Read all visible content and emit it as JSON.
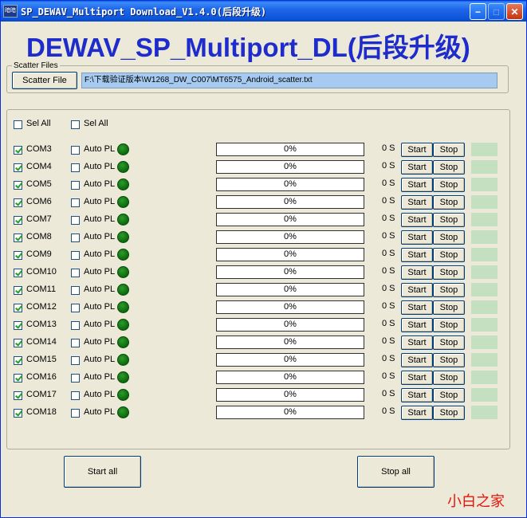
{
  "window": {
    "title": "SP_DEWAV_Multiport Download_V1.4.0(后段升级)",
    "app_icon": "暗暗",
    "minimize_glyph": "−",
    "maximize_glyph": "□",
    "close_glyph": "✕"
  },
  "banner": "DEWAV_SP_Multiport_DL(后段升级)",
  "scatter": {
    "legend": "Scatter Files",
    "button": "Scatter File",
    "path": "F:\\下载验证版本\\W1268_DW_C007\\MT6575_Android_scatter.txt"
  },
  "header": {
    "sel_all_1": "Sel All",
    "sel_all_2": "Sel All"
  },
  "ports": [
    {
      "name": "COM3",
      "checked": true,
      "auto_pl": "Auto PL",
      "progress": 0,
      "progress_text": "0%",
      "time": "0 S",
      "start": "Start",
      "stop": "Stop"
    },
    {
      "name": "COM4",
      "checked": true,
      "auto_pl": "Auto PL",
      "progress": 0,
      "progress_text": "0%",
      "time": "0 S",
      "start": "Start",
      "stop": "Stop"
    },
    {
      "name": "COM5",
      "checked": true,
      "auto_pl": "Auto PL",
      "progress": 0,
      "progress_text": "0%",
      "time": "0 S",
      "start": "Start",
      "stop": "Stop"
    },
    {
      "name": "COM6",
      "checked": true,
      "auto_pl": "Auto PL",
      "progress": 0,
      "progress_text": "0%",
      "time": "0 S",
      "start": "Start",
      "stop": "Stop"
    },
    {
      "name": "COM7",
      "checked": true,
      "auto_pl": "Auto PL",
      "progress": 0,
      "progress_text": "0%",
      "time": "0 S",
      "start": "Start",
      "stop": "Stop"
    },
    {
      "name": "COM8",
      "checked": true,
      "auto_pl": "Auto PL",
      "progress": 0,
      "progress_text": "0%",
      "time": "0 S",
      "start": "Start",
      "stop": "Stop"
    },
    {
      "name": "COM9",
      "checked": true,
      "auto_pl": "Auto PL",
      "progress": 0,
      "progress_text": "0%",
      "time": "0 S",
      "start": "Start",
      "stop": "Stop"
    },
    {
      "name": "COM10",
      "checked": true,
      "auto_pl": "Auto PL",
      "progress": 0,
      "progress_text": "0%",
      "time": "0 S",
      "start": "Start",
      "stop": "Stop"
    },
    {
      "name": "COM11",
      "checked": true,
      "auto_pl": "Auto PL",
      "progress": 0,
      "progress_text": "0%",
      "time": "0 S",
      "start": "Start",
      "stop": "Stop"
    },
    {
      "name": "COM12",
      "checked": true,
      "auto_pl": "Auto PL",
      "progress": 0,
      "progress_text": "0%",
      "time": "0 S",
      "start": "Start",
      "stop": "Stop"
    },
    {
      "name": "COM13",
      "checked": true,
      "auto_pl": "Auto PL",
      "progress": 0,
      "progress_text": "0%",
      "time": "0 S",
      "start": "Start",
      "stop": "Stop"
    },
    {
      "name": "COM14",
      "checked": true,
      "auto_pl": "Auto PL",
      "progress": 0,
      "progress_text": "0%",
      "time": "0 S",
      "start": "Start",
      "stop": "Stop"
    },
    {
      "name": "COM15",
      "checked": true,
      "auto_pl": "Auto PL",
      "progress": 0,
      "progress_text": "0%",
      "time": "0 S",
      "start": "Start",
      "stop": "Stop"
    },
    {
      "name": "COM16",
      "checked": true,
      "auto_pl": "Auto PL",
      "progress": 0,
      "progress_text": "0%",
      "time": "0 S",
      "start": "Start",
      "stop": "Stop"
    },
    {
      "name": "COM17",
      "checked": true,
      "auto_pl": "Auto PL",
      "progress": 0,
      "progress_text": "0%",
      "time": "0 S",
      "start": "Start",
      "stop": "Stop"
    },
    {
      "name": "COM18",
      "checked": true,
      "auto_pl": "Auto PL",
      "progress": 0,
      "progress_text": "0%",
      "time": "0 S",
      "start": "Start",
      "stop": "Stop"
    }
  ],
  "footer": {
    "start_all": "Start all",
    "stop_all": "Stop all"
  },
  "watermark": "小白之家",
  "colors": {
    "led": "#118811",
    "status_box": "#c5dfc1",
    "banner": "#1e2ccc",
    "path_highlight": "#a6caf0"
  }
}
